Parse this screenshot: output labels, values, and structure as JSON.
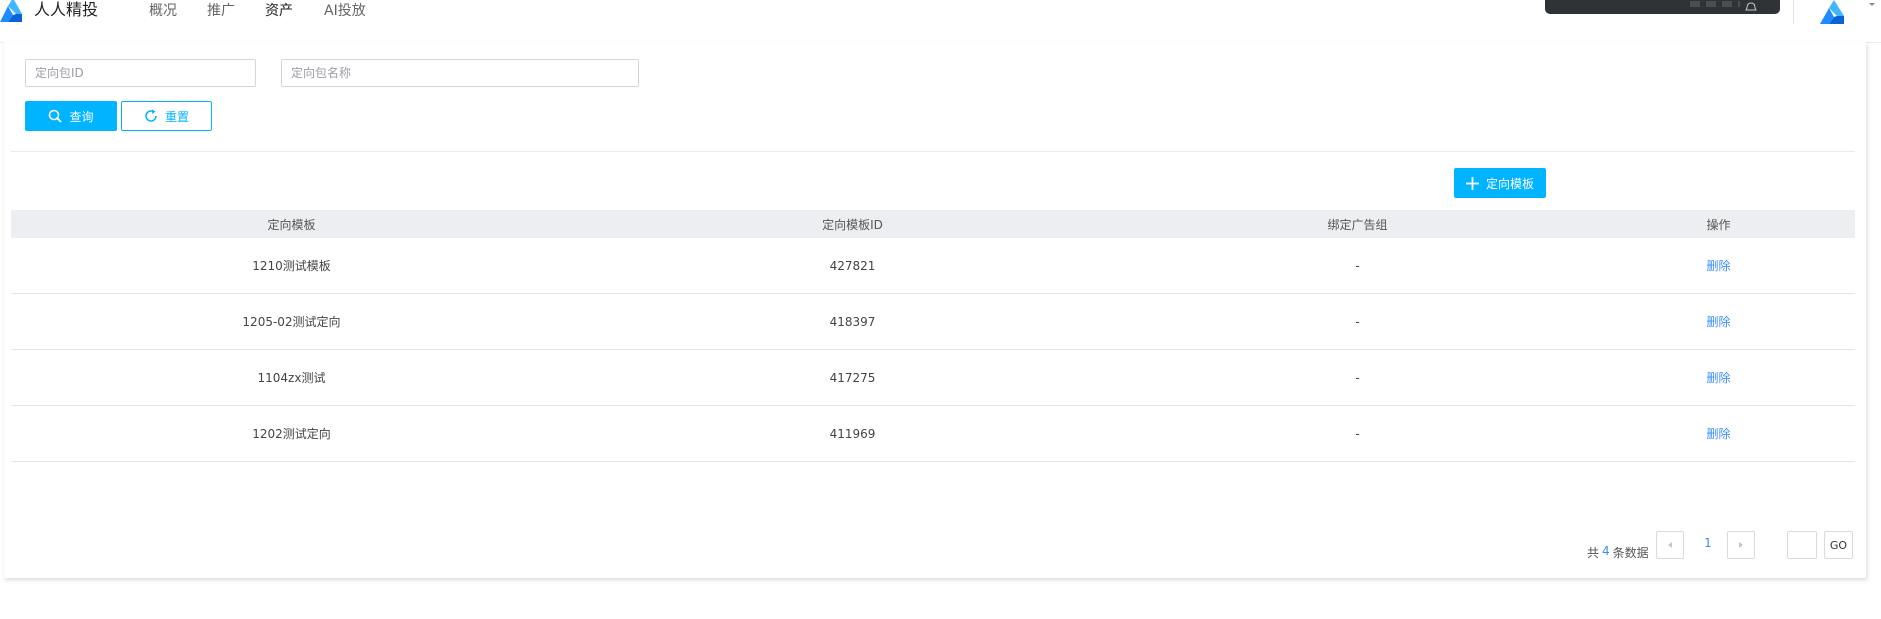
{
  "app": {
    "brand": "人人精投",
    "brand_color": "#1e8bff",
    "accent_color": "#00b4ff",
    "link_color": "#3c8df5"
  },
  "nav": {
    "items": [
      {
        "label": "概况"
      },
      {
        "label": "推广"
      },
      {
        "label": "资产",
        "active": true
      },
      {
        "label": "AI投放"
      }
    ]
  },
  "filters": {
    "package_id_placeholder": "定向包ID",
    "package_name_placeholder": "定向包名称",
    "search_label": "查询",
    "reset_label": "重置"
  },
  "toolbar": {
    "add_template_label": "定向模板"
  },
  "table": {
    "columns": [
      "定向模板",
      "定向模板ID",
      "绑定广告组",
      "操作"
    ],
    "rows": [
      {
        "name": "1210测试模板",
        "id": "427821",
        "ad_group": "-",
        "action": "删除"
      },
      {
        "name": "1205-02测试定向",
        "id": "418397",
        "ad_group": "-",
        "action": "删除"
      },
      {
        "name": "1104zx测试",
        "id": "417275",
        "ad_group": "-",
        "action": "删除"
      },
      {
        "name": "1202测试定向",
        "id": "411969",
        "ad_group": "-",
        "action": "删除"
      }
    ]
  },
  "pagination": {
    "prefix": "共",
    "total": "4",
    "suffix": "条数据",
    "current_page": "1",
    "go_label": "GO"
  },
  "icons": {
    "logo": "brand-logo-icon",
    "search": "search-icon",
    "reset": "refresh-icon",
    "add": "plus-icon",
    "prev": "chevron-left-icon",
    "next": "chevron-right-icon"
  }
}
